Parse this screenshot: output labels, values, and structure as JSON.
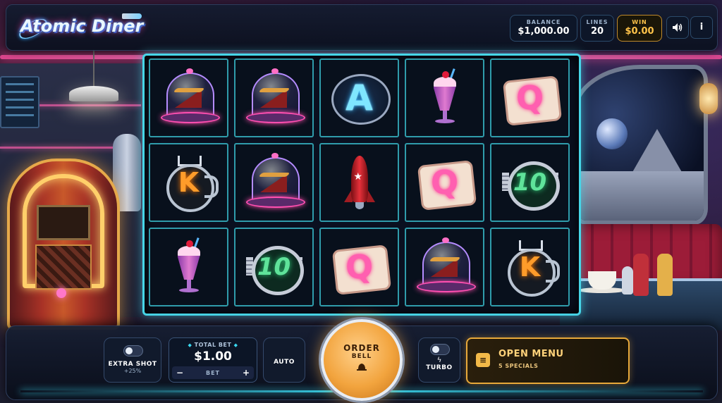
{
  "game": {
    "title": "Atomic Diner"
  },
  "header": {
    "balance": {
      "label": "BALANCE",
      "value": "$1,000.00"
    },
    "lines": {
      "label": "LINES",
      "value": "20"
    },
    "win": {
      "label": "WIN",
      "value": "$0.00"
    },
    "sound_icon": "speaker-icon",
    "info_label": "i"
  },
  "reels": {
    "rows": [
      [
        "pie",
        "pie",
        "A",
        "milkshake",
        "Q"
      ],
      [
        "K",
        "pie",
        "rocket",
        "Q",
        "10"
      ],
      [
        "milkshake",
        "10",
        "Q",
        "pie",
        "K"
      ]
    ]
  },
  "controls": {
    "extra_shot": {
      "label": "EXTRA SHOT",
      "sub": "+25%"
    },
    "total_bet": {
      "label": "TOTAL BET",
      "value": "$1.00",
      "minus": "−",
      "mid": "BET",
      "plus": "+"
    },
    "auto": {
      "label": "AUTO"
    },
    "order_bell": {
      "line1": "ORDER",
      "line2": "BELL",
      "icon": "bell-icon"
    },
    "turbo": {
      "label": "TURBO",
      "icon": "lightning-icon"
    },
    "open_menu": {
      "label": "OPEN MENU",
      "sub": "5 SPECIALS",
      "icon": "menu-icon"
    }
  },
  "colors": {
    "accent_cyan": "#3ad8f0",
    "win_gold": "#ffc44a",
    "order_orange": "#f2a43e",
    "menu_gold": "#e8a93a"
  }
}
